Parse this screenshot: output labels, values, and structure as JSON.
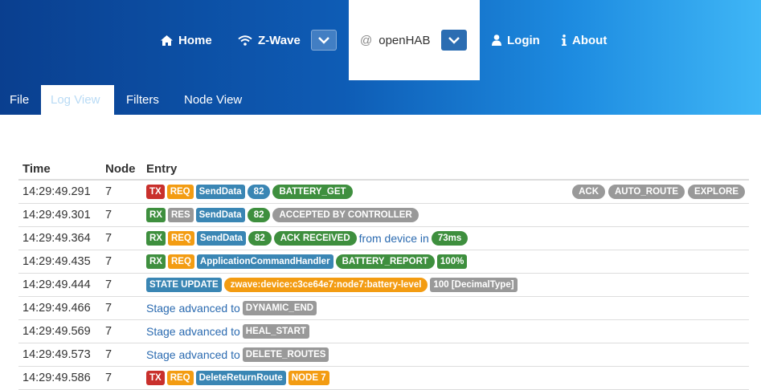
{
  "nav": {
    "home": "Home",
    "zwave": "Z-Wave",
    "openhab_at": "@",
    "openhab": "openHAB",
    "login": "Login",
    "about": "About"
  },
  "tabs": [
    "File",
    "Log View",
    "Filters",
    "Node View"
  ],
  "table": {
    "headers": [
      "Time",
      "Node",
      "Entry"
    ],
    "rows": [
      {
        "time": "14:29:49.291",
        "node": "7"
      },
      {
        "time": "14:29:49.301",
        "node": "7"
      },
      {
        "time": "14:29:49.364",
        "node": "7"
      },
      {
        "time": "14:29:49.435",
        "node": "7"
      },
      {
        "time": "14:29:49.444",
        "node": "7"
      },
      {
        "time": "14:29:49.466",
        "node": "7"
      },
      {
        "time": "14:29:49.569",
        "node": "7"
      },
      {
        "time": "14:29:49.573",
        "node": "7"
      },
      {
        "time": "14:29:49.586",
        "node": "7"
      }
    ],
    "entries": {
      "r0": {
        "dir": "TX",
        "type": "REQ",
        "func": "SendData",
        "cb": "82",
        "cmd": "BATTERY_GET",
        "flags": [
          "ACK",
          "AUTO_ROUTE",
          "EXPLORE"
        ]
      },
      "r1": {
        "dir": "RX",
        "type": "RES",
        "func": "SendData",
        "cb": "82",
        "status": "ACCEPTED BY CONTROLLER"
      },
      "r2": {
        "dir": "RX",
        "type": "REQ",
        "func": "SendData",
        "cb": "82",
        "status": "ACK RECEIVED",
        "from_text": "from device in",
        "time": "73ms"
      },
      "r3": {
        "dir": "RX",
        "type": "REQ",
        "func": "ApplicationCommandHandler",
        "cmd": "BATTERY_REPORT",
        "value": "100%"
      },
      "r4": {
        "label": "STATE UPDATE",
        "channel": "zwave:device:c3ce64e7:node7:battery-level",
        "value": "100 [DecimalType]"
      },
      "r5": {
        "text": "Stage advanced to",
        "stage": "DYNAMIC_END"
      },
      "r6": {
        "text": "Stage advanced to",
        "stage": "HEAL_START"
      },
      "r7": {
        "text": "Stage advanced to",
        "stage": "DELETE_ROUTES"
      },
      "r8": {
        "dir": "TX",
        "type": "REQ",
        "func": "DeleteReturnRoute",
        "node": "NODE 7"
      }
    }
  },
  "colors": {
    "tx": "#c9302c",
    "req": "#f39c12",
    "func": "#3a86b4",
    "cmd": "#3e8f3e",
    "neutral": "#999999"
  }
}
